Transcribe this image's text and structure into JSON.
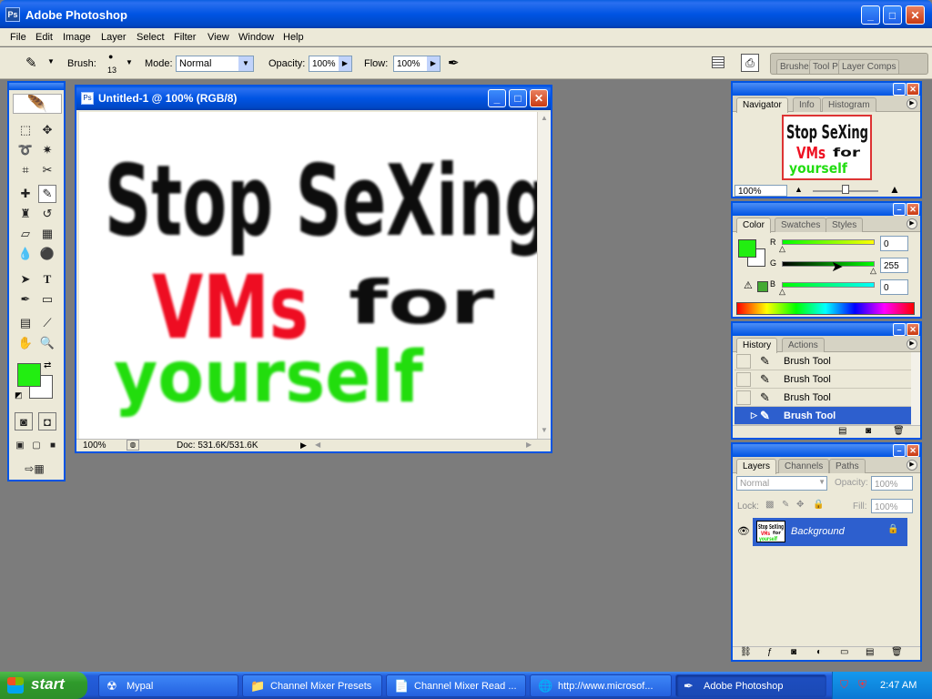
{
  "app": {
    "title": "Adobe Photoshop"
  },
  "menu": [
    "File",
    "Edit",
    "Image",
    "Layer",
    "Select",
    "Filter",
    "View",
    "Window",
    "Help"
  ],
  "options": {
    "brush_label": "Brush:",
    "brush_size": "13",
    "mode_label": "Mode:",
    "mode_value": "Normal",
    "opacity_label": "Opacity:",
    "opacity_value": "100%",
    "flow_label": "Flow:",
    "flow_value": "100%",
    "well_tabs": [
      "Brushe",
      "Tool Pr",
      "Layer Comps"
    ]
  },
  "document": {
    "title": "Untitled-1 @ 100% (RGB/8)",
    "zoom": "100%",
    "doc_info": "Doc: 531.6K/531.6K",
    "canvas_text": {
      "line1": "Stop SeXing",
      "line2a": "VMs",
      "line2b": "for",
      "line3": "yourself"
    }
  },
  "colors": {
    "foreground": "#22ee11",
    "ink_black": "#111111",
    "ink_red": "#ee1122",
    "ink_green": "#22dd11",
    "accent": "#0054e3"
  },
  "navigator": {
    "tabs": [
      "Navigator",
      "Info",
      "Histogram"
    ],
    "zoom": "100%"
  },
  "color_panel": {
    "tabs": [
      "Color",
      "Swatches",
      "Styles"
    ],
    "r_label": "R",
    "r_value": "0",
    "g_label": "G",
    "g_value": "255",
    "b_label": "B",
    "b_value": "0"
  },
  "history": {
    "tabs": [
      "History",
      "Actions"
    ],
    "items": [
      "Brush Tool",
      "Brush Tool",
      "Brush Tool",
      "Brush Tool"
    ]
  },
  "layers": {
    "tabs": [
      "Layers",
      "Channels",
      "Paths"
    ],
    "blend_mode": "Normal",
    "opacity_label": "Opacity:",
    "opacity_value": "100%",
    "lock_label": "Lock:",
    "fill_label": "Fill:",
    "fill_value": "100%",
    "layer_name": "Background"
  },
  "taskbar": {
    "start_label": "start",
    "buttons": [
      "Mypal",
      "Channel Mixer Presets",
      "Channel Mixer Read ...",
      "http://www.microsof...",
      "Adobe Photoshop"
    ],
    "clock": "2:47 AM"
  }
}
